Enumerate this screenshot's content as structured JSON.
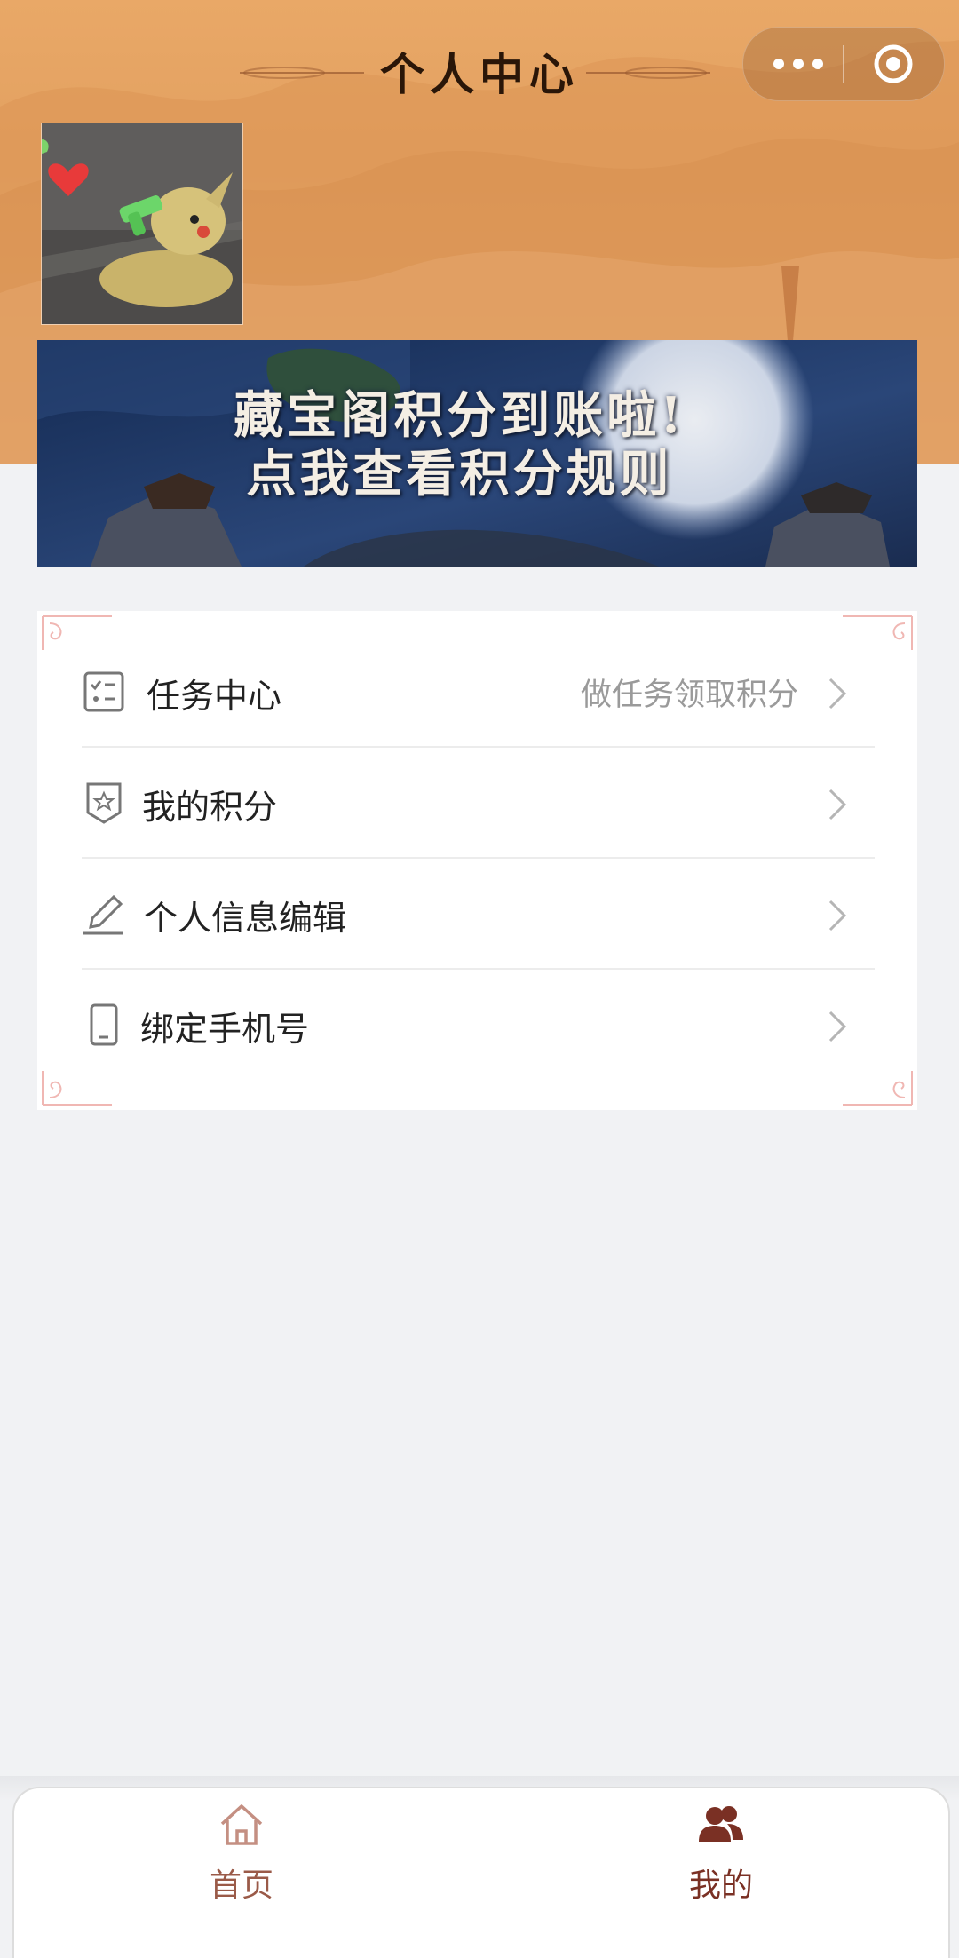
{
  "nav": {
    "title": "个人中心",
    "more_icon": "more-dots-icon",
    "close_icon": "target-close-icon"
  },
  "banner": {
    "line1": "藏宝阁积分到账啦!",
    "line2": "点我查看积分规则"
  },
  "menu": [
    {
      "label": "任务中心",
      "hint": "做任务领取积分",
      "icon": "task-list-icon"
    },
    {
      "label": "我的积分",
      "hint": "",
      "icon": "points-badge-icon"
    },
    {
      "label": "个人信息编辑",
      "hint": "",
      "icon": "pencil-icon"
    },
    {
      "label": "绑定手机号",
      "hint": "",
      "icon": "phone-icon"
    }
  ],
  "tabbar": {
    "tabs": [
      {
        "label": "首页",
        "icon": "home-icon",
        "active": false
      },
      {
        "label": "我的",
        "icon": "users-icon",
        "active": true
      }
    ]
  },
  "colors": {
    "header": "#e3a264",
    "accent": "#7a3024",
    "tab_inactive": "#9a5a48",
    "page_bg": "#f1f2f4"
  }
}
